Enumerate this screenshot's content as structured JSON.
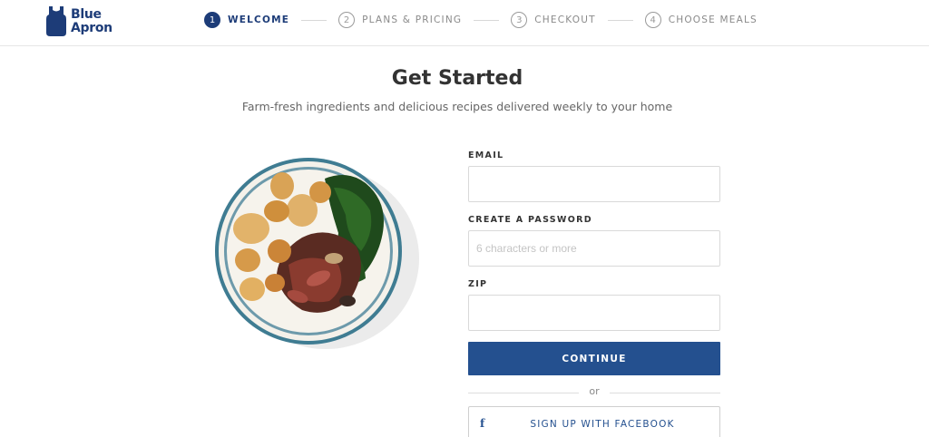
{
  "brand": {
    "line1": "Blue",
    "line2": "Apron",
    "color": "#1d3c78"
  },
  "steps": [
    {
      "num": "1",
      "label": "WELCOME",
      "active": true
    },
    {
      "num": "2",
      "label": "PLANS & PRICING",
      "active": false
    },
    {
      "num": "3",
      "label": "CHECKOUT",
      "active": false
    },
    {
      "num": "4",
      "label": "CHOOSE MEALS",
      "active": false
    }
  ],
  "main": {
    "title": "Get Started",
    "subtitle": "Farm-fresh ingredients and delicious recipes delivered weekly to your home"
  },
  "form": {
    "email_label": "EMAIL",
    "email_value": "",
    "password_label": "CREATE A PASSWORD",
    "password_placeholder": "6 characters or more",
    "zip_label": "ZIP",
    "zip_value": "",
    "continue_label": "CONTINUE",
    "or_text": "or",
    "facebook_label": "SIGN UP WITH FACEBOOK",
    "facebook_icon": "facebook-icon"
  },
  "colors": {
    "primary": "#24508f",
    "brand": "#1d3c78"
  }
}
